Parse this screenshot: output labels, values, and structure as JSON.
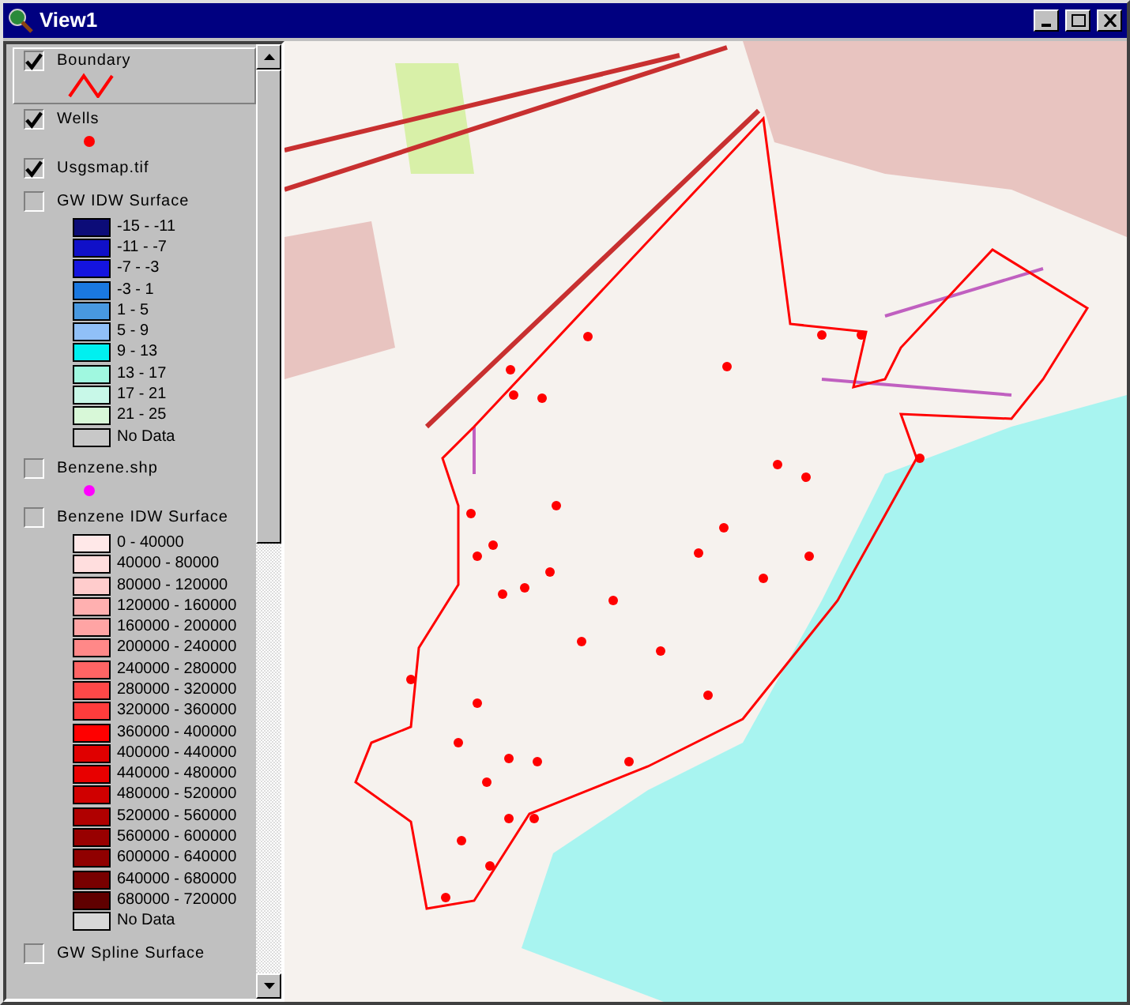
{
  "window": {
    "title": "View1"
  },
  "layers": [
    {
      "kind": "line",
      "name": "Boundary",
      "checked": true,
      "selected": true,
      "color": "#ff0000"
    },
    {
      "kind": "point",
      "name": "Wells",
      "checked": true,
      "selected": false,
      "color": "#ff0000"
    },
    {
      "kind": "image",
      "name": "Usgsmap.tif",
      "checked": true,
      "selected": false
    },
    {
      "kind": "ramp",
      "name": "GW IDW Surface",
      "checked": false,
      "selected": false,
      "classes": [
        {
          "label": "-15 - -11",
          "color": "#0c0c78"
        },
        {
          "label": "-11 - -7",
          "color": "#1010c8"
        },
        {
          "label": "-7 - -3",
          "color": "#1414e0"
        },
        {
          "label": "-3 - 1",
          "color": "#1a78e0"
        },
        {
          "label": "1 - 5",
          "color": "#4898e0"
        },
        {
          "label": "5 - 9",
          "color": "#90c0f8"
        },
        {
          "label": "9 - 13",
          "color": "#00f0f0"
        },
        {
          "label": "13 - 17",
          "color": "#a0f8e0"
        },
        {
          "label": "17 - 21",
          "color": "#c8f8e8"
        },
        {
          "label": "21 - 25",
          "color": "#d8f8d8"
        },
        {
          "label": "No Data",
          "color": "#c8c8c8"
        }
      ]
    },
    {
      "kind": "point",
      "name": "Benzene.shp",
      "checked": false,
      "selected": false,
      "color": "#ff00ff"
    },
    {
      "kind": "ramp",
      "name": "Benzene IDW Surface",
      "checked": false,
      "selected": false,
      "classes": [
        {
          "label": "0 - 40000",
          "color": "#ffe8e8"
        },
        {
          "label": "40000 - 80000",
          "color": "#ffdede"
        },
        {
          "label": "80000 - 120000",
          "color": "#ffcccc"
        },
        {
          "label": "120000 - 160000",
          "color": "#ffb0b0"
        },
        {
          "label": "160000 - 200000",
          "color": "#ffa4a4"
        },
        {
          "label": "200000 - 240000",
          "color": "#ff8888"
        },
        {
          "label": "240000 - 280000",
          "color": "#ff6464"
        },
        {
          "label": "280000 - 320000",
          "color": "#ff4848"
        },
        {
          "label": "320000 - 360000",
          "color": "#ff3c3c"
        },
        {
          "label": "360000 - 400000",
          "color": "#ff0000"
        },
        {
          "label": "400000 - 440000",
          "color": "#e00000"
        },
        {
          "label": "440000 - 480000",
          "color": "#e80000"
        },
        {
          "label": "480000 - 520000",
          "color": "#d00000"
        },
        {
          "label": "520000 - 560000",
          "color": "#b00000"
        },
        {
          "label": "560000 - 600000",
          "color": "#980000"
        },
        {
          "label": "600000 - 640000",
          "color": "#900000"
        },
        {
          "label": "640000 - 680000",
          "color": "#780000"
        },
        {
          "label": "680000 - 720000",
          "color": "#600000"
        },
        {
          "label": "No Data",
          "color": "#d8d8d8"
        }
      ]
    },
    {
      "kind": "header",
      "name": "GW Spline Surface",
      "checked": false,
      "selected": false
    }
  ]
}
